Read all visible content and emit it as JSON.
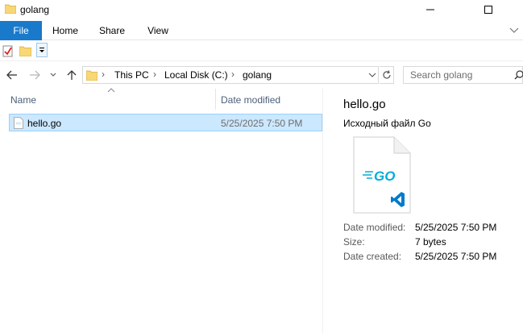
{
  "window": {
    "title": "golang"
  },
  "ribbon": {
    "tabs": [
      {
        "label": "File"
      },
      {
        "label": "Home"
      },
      {
        "label": "Share"
      },
      {
        "label": "View"
      }
    ]
  },
  "address": {
    "crumbs": [
      "This PC",
      "Local Disk (C:)",
      "golang"
    ]
  },
  "search": {
    "placeholder": "Search golang"
  },
  "filelist": {
    "columns": {
      "name": "Name",
      "date": "Date modified"
    },
    "rows": [
      {
        "name": "hello.go",
        "date": "5/25/2025 7:50 PM",
        "selected": true
      }
    ]
  },
  "preview": {
    "name": "hello.go",
    "type": "Исходный файл Go",
    "icon_text": "GO",
    "details": [
      {
        "label": "Date modified:",
        "value": "5/25/2025 7:50 PM"
      },
      {
        "label": "Size:",
        "value": "7 bytes"
      },
      {
        "label": "Date created:",
        "value": "5/25/2025 7:50 PM"
      }
    ]
  },
  "colors": {
    "accent": "#1979ca",
    "selection": "#cce8ff",
    "selection_border": "#99d1ff",
    "folder": "#f8d775",
    "go_blue": "#00add8",
    "vscode_blue": "#007acc"
  }
}
